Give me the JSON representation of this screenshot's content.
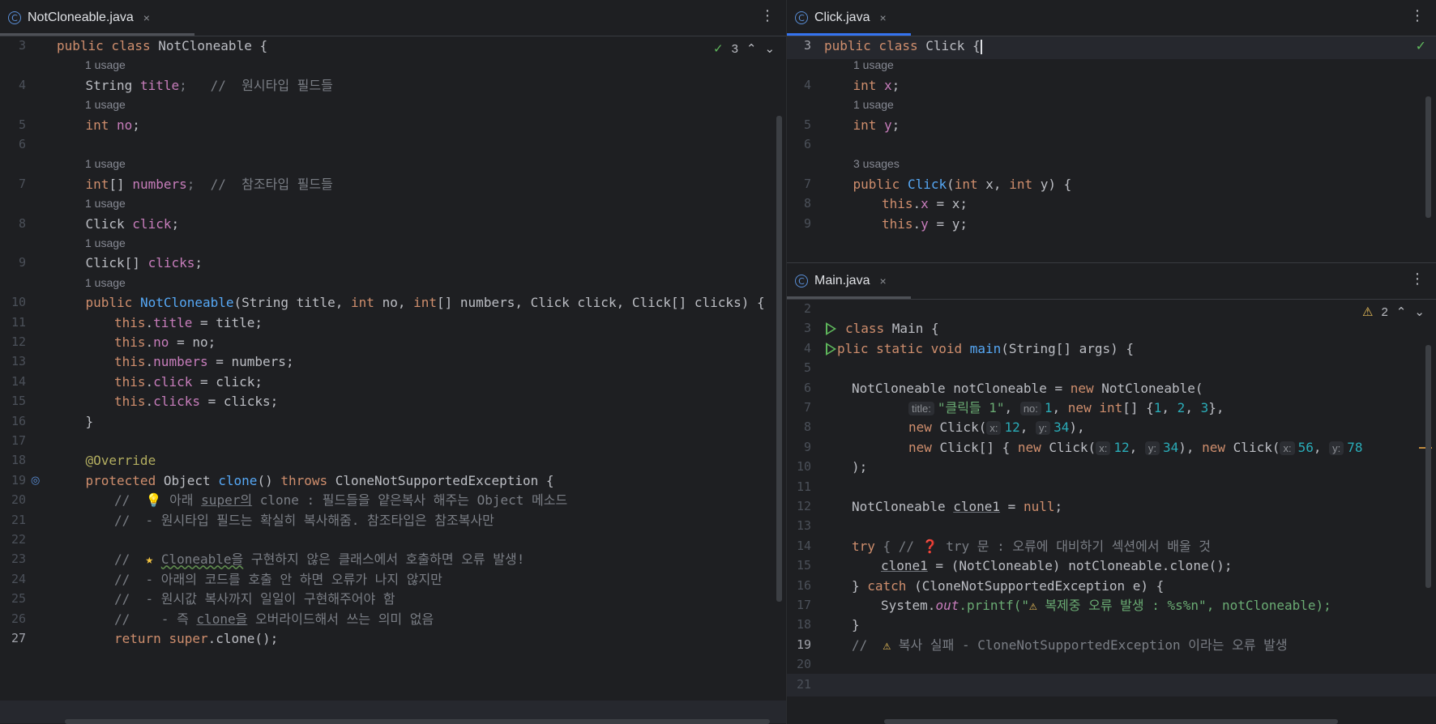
{
  "left": {
    "tab": {
      "label": "NotCloneable.java",
      "close": "×"
    },
    "inspection": {
      "count": "3"
    },
    "lines": [
      {
        "n": "3"
      },
      {
        "hint": "1 usage"
      },
      {
        "n": "4"
      },
      {
        "hint": "1 usage"
      },
      {
        "n": "5"
      },
      {
        "n": "6"
      },
      {
        "hint": "1 usage"
      },
      {
        "n": "7"
      },
      {
        "hint": "1 usage"
      },
      {
        "n": "8"
      },
      {
        "hint": "1 usage"
      },
      {
        "n": "9"
      },
      {
        "hint": "1 usage"
      },
      {
        "n": "10"
      },
      {
        "n": "11"
      },
      {
        "n": "12"
      },
      {
        "n": "13"
      },
      {
        "n": "14"
      },
      {
        "n": "15"
      },
      {
        "n": "16"
      },
      {
        "n": "17"
      },
      {
        "n": "18"
      },
      {
        "n": "19"
      },
      {
        "n": "20"
      },
      {
        "n": "21"
      },
      {
        "n": "22"
      },
      {
        "n": "23"
      },
      {
        "n": "24"
      },
      {
        "n": "25"
      },
      {
        "n": "26"
      },
      {
        "n": "27"
      }
    ],
    "text": {
      "l3": [
        "public class ",
        "NotCloneable {"
      ],
      "l4": [
        "String ",
        "title",
        ";   //  원시타입 필드들"
      ],
      "l5": [
        "int ",
        "no",
        ";"
      ],
      "l7": [
        "int",
        "[] ",
        "numbers",
        ";  //  참조타입 필드들"
      ],
      "l8": [
        "Click ",
        "click",
        ";"
      ],
      "l9": [
        "Click[] ",
        "clicks",
        ";"
      ],
      "l10": [
        "public ",
        "NotCloneable",
        "(String title, ",
        "int",
        " no, ",
        "int",
        "[] numbers, Click click, Click[] clicks) {"
      ],
      "l11": [
        "this",
        ".",
        "title",
        " = title;"
      ],
      "l12": [
        "this",
        ".",
        "no",
        " = no;"
      ],
      "l13": [
        "this",
        ".",
        "numbers",
        " = numbers;"
      ],
      "l14": [
        "this",
        ".",
        "click",
        " = click;"
      ],
      "l15": [
        "this",
        ".",
        "clicks",
        " = clicks;"
      ],
      "l16": "}",
      "l18": "@Override",
      "l19": [
        "protected ",
        "Object ",
        "clone",
        "() ",
        "throws ",
        "CloneNotSupportedException {"
      ],
      "l20": [
        "//  ",
        "💡",
        " 아래 ",
        "super의",
        " clone : 필드들을 얕은복사 해주는 Object 메소드"
      ],
      "l21": "//  - 원시타입 필드는 확실히 복사해줌. 참조타입은 참조복사만",
      "l23": [
        "//  ",
        "★",
        " ",
        "Cloneable을",
        " 구현하지 않은 클래스에서 호출하면 오류 발생!"
      ],
      "l24": "//  - 아래의 코드를 호출 안 하면 오류가 나지 않지만",
      "l25": "//  - 원시값 복사까지 일일이 구현해주어야 함",
      "l26": [
        "//    - 즉 ",
        "clone을",
        " 오버라이드해서 쓰는 의미 없음"
      ],
      "l27": [
        "return ",
        "super",
        ".clone();"
      ]
    }
  },
  "rtop": {
    "tab": {
      "label": "Click.java",
      "close": "×"
    },
    "lines": [
      {
        "n": "3"
      },
      {
        "hint": "1 usage"
      },
      {
        "n": "4"
      },
      {
        "hint": "1 usage"
      },
      {
        "n": "5"
      },
      {
        "n": "6"
      },
      {
        "hint": "3 usages"
      },
      {
        "n": "7"
      },
      {
        "n": "8"
      },
      {
        "n": "9"
      }
    ],
    "text": {
      "l3": [
        "public class ",
        "Click ",
        "{"
      ],
      "l4": [
        "int ",
        "x",
        ";"
      ],
      "l5": [
        "int ",
        "y",
        ";"
      ],
      "l7": [
        "public ",
        "Click",
        "(",
        "int",
        " x, ",
        "int",
        " y) {"
      ],
      "l8": [
        "this",
        ".",
        "x",
        " = x;"
      ],
      "l9": [
        "this",
        ".",
        "y",
        " = y;"
      ]
    }
  },
  "rbot": {
    "tab": {
      "label": "Main.java",
      "close": "×"
    },
    "inspection": {
      "count": "2"
    },
    "lines": [
      {
        "n": "2"
      },
      {
        "n": "3"
      },
      {
        "n": "4"
      },
      {
        "n": "5"
      },
      {
        "n": "6"
      },
      {
        "n": "7"
      },
      {
        "n": "8"
      },
      {
        "n": "9"
      },
      {
        "n": "10"
      },
      {
        "n": "11"
      },
      {
        "n": "12"
      },
      {
        "n": "13"
      },
      {
        "n": "14"
      },
      {
        "n": "15"
      },
      {
        "n": "16"
      },
      {
        "n": "17"
      },
      {
        "n": "18"
      },
      {
        "n": "19"
      },
      {
        "n": "20"
      },
      {
        "n": "21"
      }
    ],
    "text": {
      "l3": [
        "class ",
        "Main {"
      ],
      "l4": [
        "plic static void ",
        "main",
        "(String[] args) {"
      ],
      "l6": [
        "NotCloneable notCloneable = ",
        "new ",
        "NotCloneable("
      ],
      "l7": {
        "p1": "title:",
        "s1": "\"클릭들 1\"",
        "c1": ", ",
        "p2": "no:",
        "n1": "1",
        "c2": ", ",
        "k1": "new ",
        "k2": "int",
        "c3": "[] {",
        "n2": "1",
        "c4": ", ",
        "n3": "2",
        "c5": ", ",
        "n4": "3",
        "c6": "},"
      },
      "l8": {
        "k1": "new ",
        "c1": "Click(",
        "p1": "x:",
        "n1": "12",
        "c2": ", ",
        "p2": "y:",
        "n2": "34",
        "c3": "),"
      },
      "l9": {
        "k1": "new ",
        "c1": "Click[] { ",
        "k2": "new ",
        "c2": "Click(",
        "p1": "x:",
        "n1": "12",
        "c3": ", ",
        "p2": "y:",
        "n2": "34",
        "c4": "), ",
        "k3": "new ",
        "c5": "Click(",
        "p3": "x:",
        "n3": "56",
        "c6": ", ",
        "p4": "y:",
        "n4": "78"
      },
      "l10": ");",
      "l12": [
        "NotCloneable ",
        "clone1",
        " = ",
        "null",
        ";"
      ],
      "l14": [
        "try ",
        "{ // ",
        "❓",
        " try 문 : 오류에 대비하기 섹션에서 배울 것"
      ],
      "l15": [
        "clone1",
        " = (NotCloneable) notCloneable.clone();"
      ],
      "l16": [
        "} ",
        "catch ",
        "(CloneNotSupportedException e) {"
      ],
      "l17": [
        "System.",
        "out",
        ".printf(\"",
        "⚠",
        " 복제중 오류 발생 : %s%n\", notCloneable);"
      ],
      "l18": "}",
      "l19": [
        "//  ",
        "⚠",
        " 복사 실패 - CloneNotSupportedException 이라는 오류 발생"
      ]
    }
  }
}
